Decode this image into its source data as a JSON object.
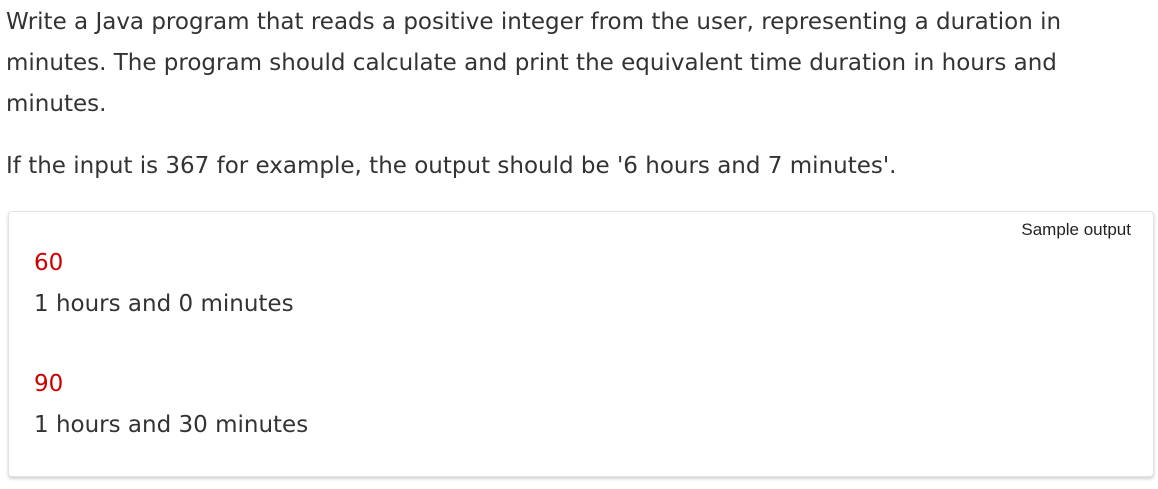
{
  "problem": {
    "description": "Write a Java program that reads a positive integer from the user, representing a duration in minutes. The program should calculate and print the equivalent time duration in hours and minutes.",
    "example": "If the input is 367 for example, the output should be '6 hours and 7 minutes'."
  },
  "sample_output": {
    "title": "Sample output",
    "cases": [
      {
        "input": "60",
        "output": "1 hours and 0 minutes"
      },
      {
        "input": "90",
        "output": "1 hours and 30 minutes"
      }
    ]
  },
  "colors": {
    "input_text": "#cc0000",
    "body_text": "#333333"
  }
}
